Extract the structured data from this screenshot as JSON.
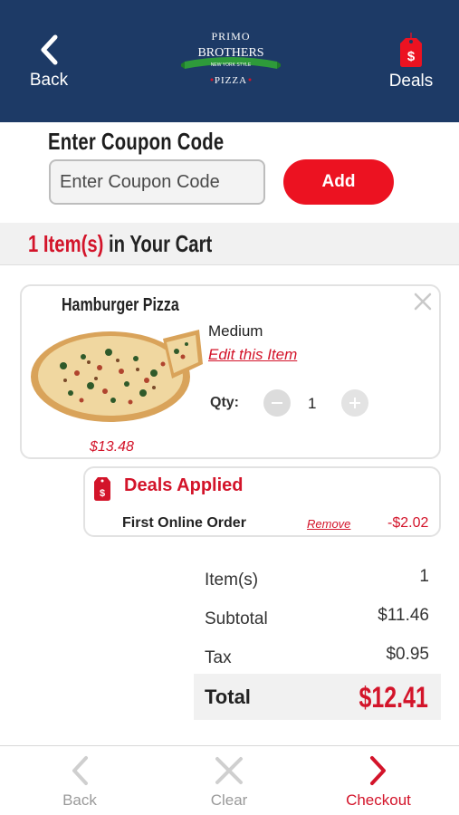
{
  "header": {
    "back_label": "Back",
    "deals_label": "Deals",
    "logo": {
      "line1": "PRIMO",
      "line2": "BROTHERS",
      "banner": "NEW YORK STYLE",
      "line3": "PIZZA"
    }
  },
  "coupon": {
    "title": "Enter Coupon Code",
    "placeholder": "Enter Coupon Code",
    "add_label": "Add"
  },
  "cart": {
    "count_text": "1 Item(s)",
    "title_suffix": "in Your Cart"
  },
  "item": {
    "name": "Hamburger Pizza",
    "size": "Medium",
    "edit_label": "Edit this Item",
    "qty_label": "Qty:",
    "qty": "1",
    "price": "$13.48"
  },
  "deals": {
    "title": "Deals Applied",
    "name": "First Online Order",
    "remove_label": "Remove",
    "amount": "-$2.02"
  },
  "summary": {
    "items_label": "Item(s)",
    "items_value": "1",
    "subtotal_label": "Subtotal",
    "subtotal_value": "$11.46",
    "tax_label": "Tax",
    "tax_value": "$0.95",
    "total_label": "Total",
    "total_value": "$12.41"
  },
  "bottom_nav": {
    "back_label": "Back",
    "clear_label": "Clear",
    "checkout_label": "Checkout"
  },
  "colors": {
    "header_bg": "#1d3a66",
    "accent_red": "#ec1221",
    "text_red": "#d3142a"
  }
}
